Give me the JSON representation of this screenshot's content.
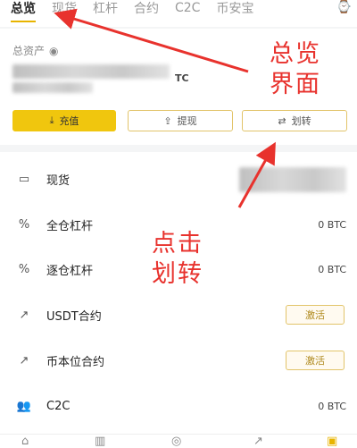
{
  "tabs": [
    {
      "label": "总览",
      "active": true
    },
    {
      "label": "现货"
    },
    {
      "label": "杠杆"
    },
    {
      "label": "合约"
    },
    {
      "label": "C2C"
    },
    {
      "label": "币安宝"
    }
  ],
  "assets": {
    "label": "总资产",
    "currency_suffix": "TC"
  },
  "actions": {
    "deposit": "充值",
    "withdraw": "提现",
    "transfer": "划转"
  },
  "accounts": [
    {
      "icon": "wallet-icon",
      "label": "现货",
      "value": ""
    },
    {
      "icon": "percent-icon",
      "label": "全仓杠杆",
      "value": "0 BTC"
    },
    {
      "icon": "percent-icon",
      "label": "逐仓杠杆",
      "value": "0 BTC"
    },
    {
      "icon": "futures-icon",
      "label": "USDT合约",
      "action": "激活"
    },
    {
      "icon": "futures-icon",
      "label": "币本位合约",
      "action": "激活"
    },
    {
      "icon": "people-icon",
      "label": "C2C",
      "value": "0 BTC"
    }
  ],
  "annotations": {
    "overview": [
      "总览",
      "界面"
    ],
    "click_transfer": [
      "点击",
      "划转"
    ]
  },
  "colors": {
    "accent": "#f0c60e",
    "annotation": "#e8322d"
  }
}
